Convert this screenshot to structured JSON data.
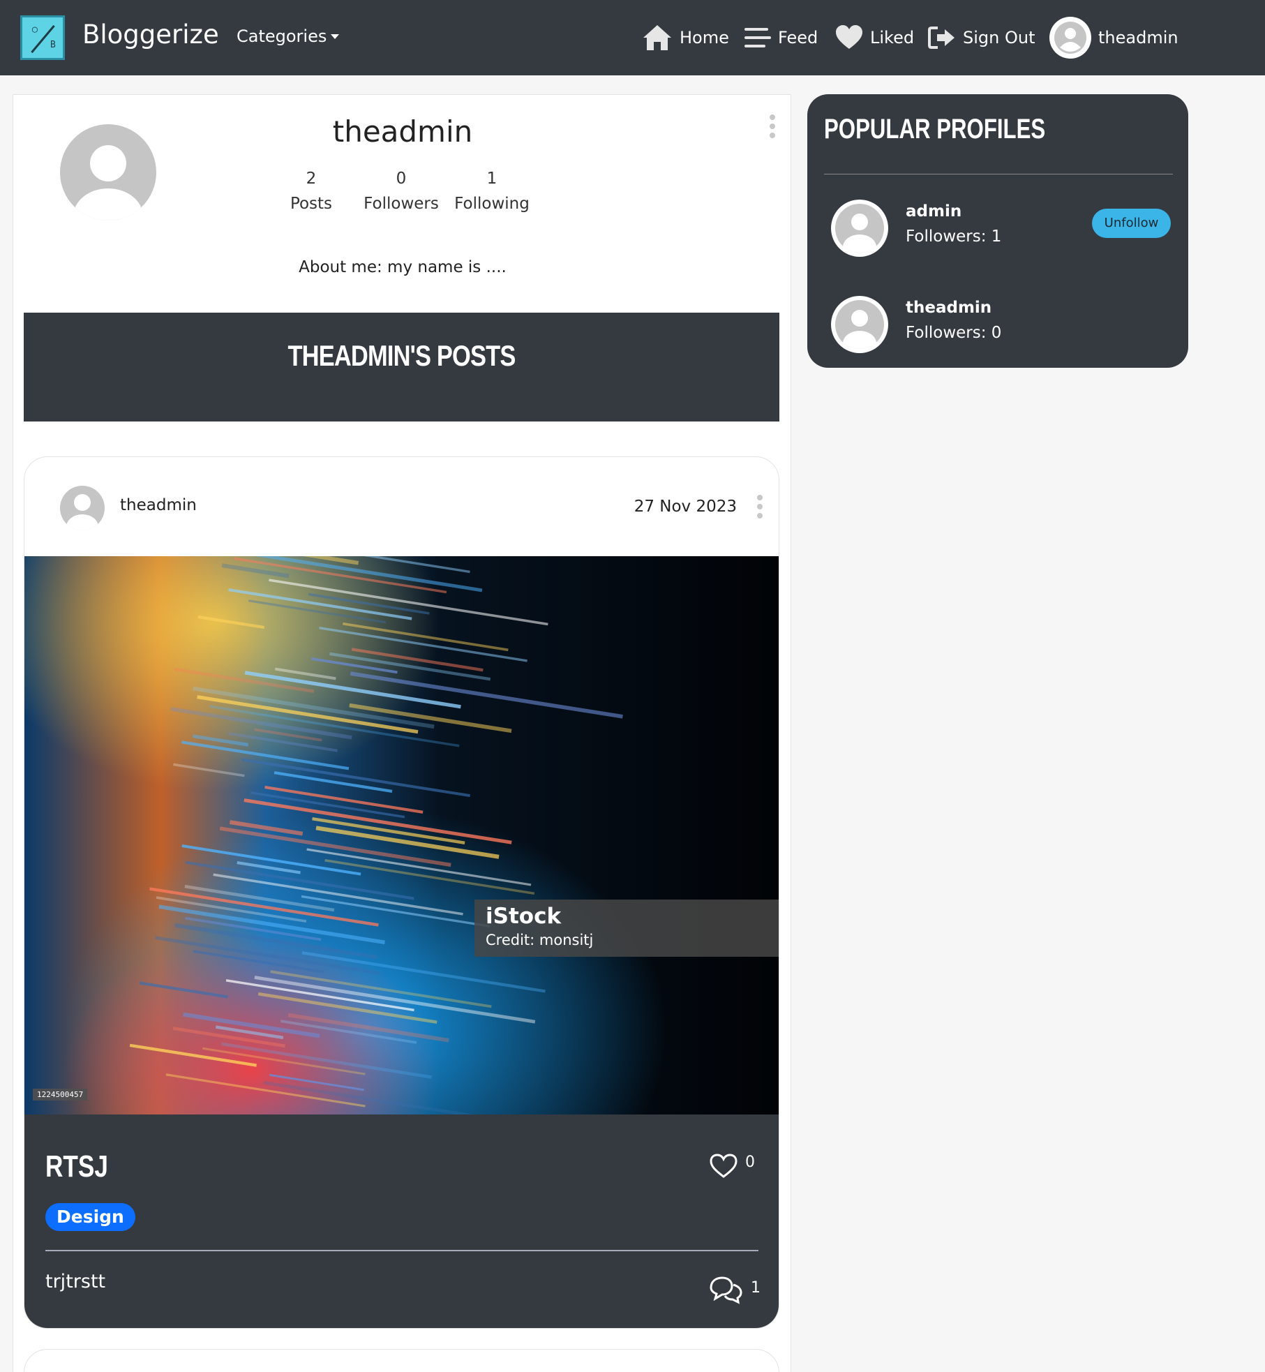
{
  "navbar": {
    "brand": "Bloggerize",
    "categories_label": "Categories",
    "home_label": "Home",
    "feed_label": "Feed",
    "liked_label": "Liked",
    "signout_label": "Sign Out",
    "username": "theadmin"
  },
  "profile": {
    "username": "theadmin",
    "posts_count": "2",
    "posts_label": "Posts",
    "followers_count": "0",
    "followers_label": "Followers",
    "following_count": "1",
    "following_label": "Following",
    "about": "About me: my name is ...."
  },
  "posts_section": {
    "title": "THEADMIN'S POSTS"
  },
  "post": {
    "author": "theadmin",
    "date": "27 Nov 2023",
    "image_watermark_brand": "iStock",
    "image_watermark_credit": "Credit: monsitj",
    "image_id": "1224500457",
    "title": "RTSJ",
    "likes": "0",
    "tag": "Design",
    "text": "trjtrstt",
    "comments": "1"
  },
  "popular_profiles": {
    "title": "POPULAR PROFILES",
    "items": [
      {
        "name": "admin",
        "followers": "Followers: 1",
        "button": "Unfollow"
      },
      {
        "name": "theadmin",
        "followers": "Followers: 0"
      }
    ]
  },
  "colors": {
    "navbar_bg": "#343a40",
    "accent_blue": "#0d6efd",
    "unfollow_button": "#3bb5e8"
  }
}
